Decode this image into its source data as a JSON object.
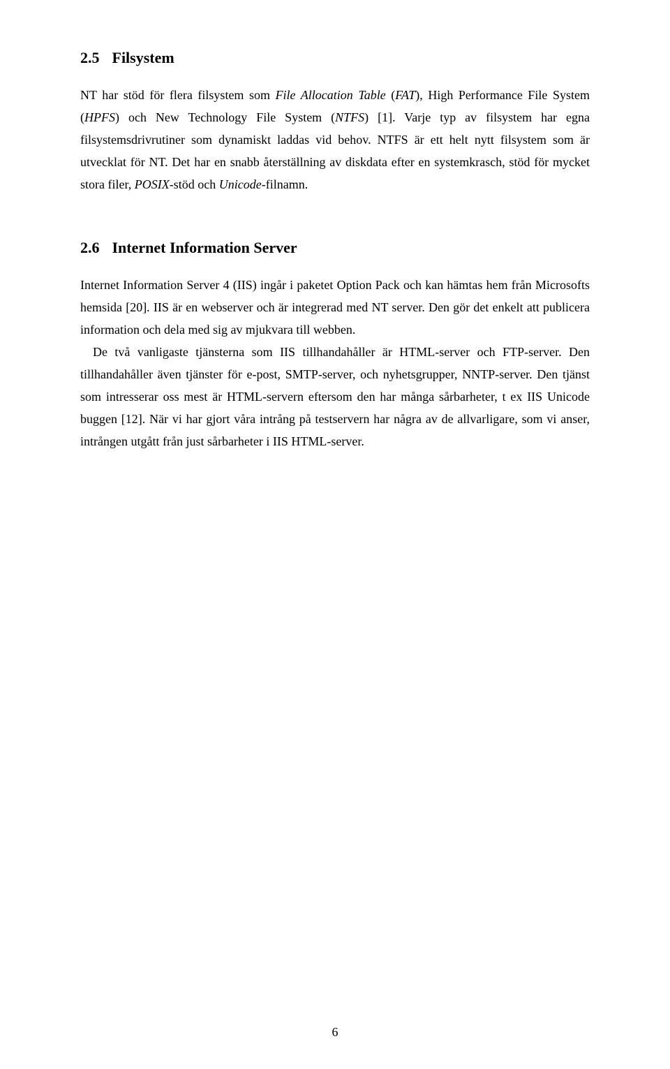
{
  "section1": {
    "number": "2.5",
    "title": "Filsystem",
    "p1_a": "NT har stöd för flera filsystem som ",
    "p1_i1": "File Allocation Table",
    "p1_b": " (",
    "p1_i2": "FAT",
    "p1_c": "), High Performance File System (",
    "p1_i3": "HPFS",
    "p1_d": ") och New Technology File System (",
    "p1_i4": "NTFS",
    "p1_e": ") [1]. Varje typ av filsystem har egna filsystemsdrivrutiner som dynamiskt laddas vid behov. NTFS är ett helt nytt filsystem som är utvecklat för NT. Det har en snabb återställning av diskdata efter en systemkrasch, stöd för mycket stora filer, ",
    "p1_i5": "POSIX",
    "p1_f": "-stöd och ",
    "p1_i6": "Unicode",
    "p1_g": "-filnamn."
  },
  "section2": {
    "number": "2.6",
    "title": "Internet Information Server",
    "p1": "Internet Information Server 4 (IIS) ingår i paketet Option Pack och kan hämtas hem från Microsofts hemsida [20]. IIS är en webserver och är integrerad med NT server. Den gör det enkelt att publicera information och dela med sig av mjukvara till webben.",
    "p2": "De två vanligaste tjänsterna som IIS tillhandahåller är HTML-server och FTP-server. Den tillhandahåller även tjänster för e-post, SMTP-server, och nyhetsgrupper, NNTP-server. Den tjänst som intresserar oss mest är HTML-servern eftersom den har många sårbarheter, t ex IIS Unicode buggen [12]. När vi har gjort våra intrång på testservern har några av de allvarligare, som vi anser, intrången utgått från just sårbarheter i IIS HTML-server."
  },
  "page_number": "6"
}
